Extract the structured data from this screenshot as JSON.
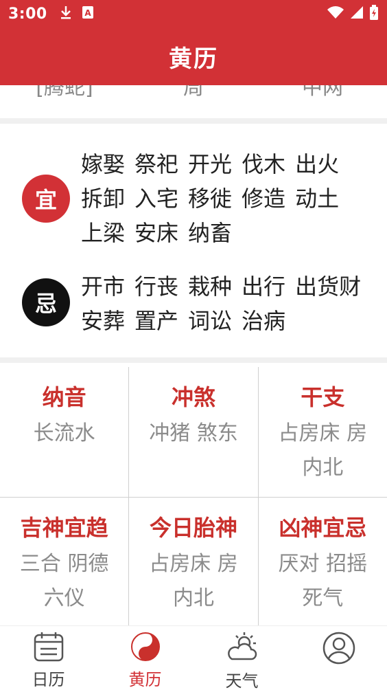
{
  "status_bar": {
    "time": "3:00",
    "left_icons": [
      "download-icon",
      "a-box-icon"
    ],
    "right_icons": [
      "wifi-icon",
      "cell-signal-icon",
      "battery-icon"
    ]
  },
  "app_bar": {
    "title": "黄历"
  },
  "clipped_top_row": [
    "[腾蛇]",
    "周",
    "中网"
  ],
  "yi": {
    "badge": "宜",
    "items": [
      "嫁娶",
      "祭祀",
      "开光",
      "伐木",
      "出火",
      "拆卸",
      "入宅",
      "移徙",
      "修造",
      "动土",
      "上梁",
      "安床",
      "纳畜"
    ]
  },
  "ji": {
    "badge": "忌",
    "items": [
      "开市",
      "行丧",
      "栽种",
      "出行",
      "出货财",
      "安葬",
      "置产",
      "词讼",
      "治病"
    ]
  },
  "info_grid": [
    [
      {
        "title": "纳音",
        "value": "长流水"
      },
      {
        "title": "冲煞",
        "value": "冲猪 煞东"
      },
      {
        "title": "干支",
        "value": "占房床 房内北"
      }
    ],
    [
      {
        "title": "吉神宜趋",
        "value": "三合 阴德 六仪"
      },
      {
        "title": "今日胎神",
        "value": "占房床 房内北"
      },
      {
        "title": "凶神宜忌",
        "value": "厌对 招摇 死气"
      }
    ]
  ],
  "tabs": [
    {
      "label": "日历",
      "icon": "calendar-icon",
      "active": false
    },
    {
      "label": "黄历",
      "icon": "yin-yang-icon",
      "active": true
    },
    {
      "label": "天气",
      "icon": "weather-icon",
      "active": false
    },
    {
      "label": "",
      "icon": "profile-icon",
      "active": false
    }
  ],
  "colors": {
    "primary": "#d23136",
    "accent_text": "#c9302c",
    "muted_text": "#8b8b8b"
  }
}
